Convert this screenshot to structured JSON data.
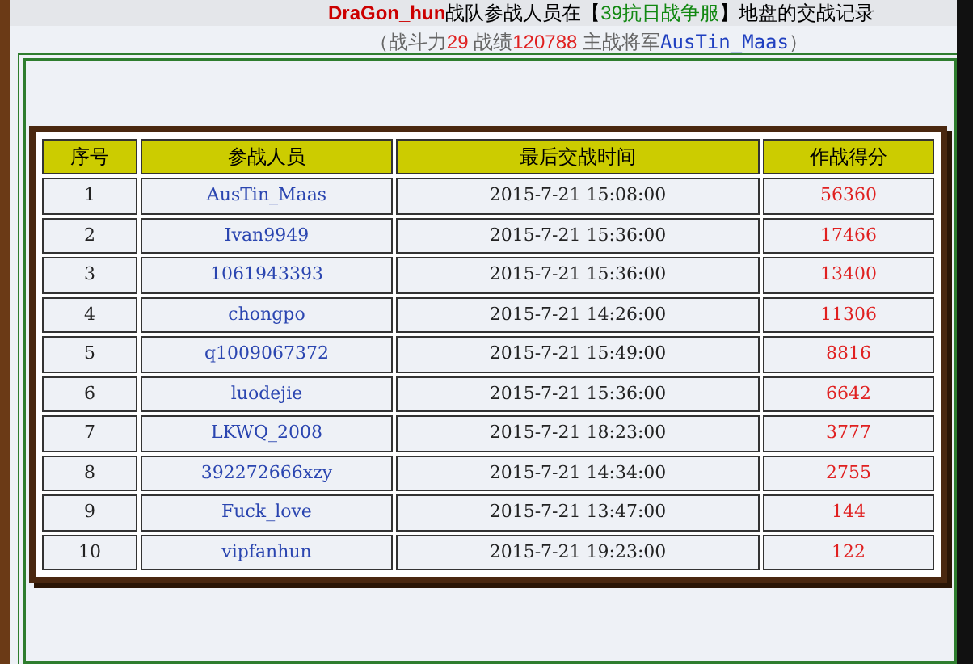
{
  "title": {
    "team": "DraGon_hun",
    "text_before": "战队参战人员在【",
    "server": "39抗日战争服",
    "text_after": "】地盘的交战记录"
  },
  "summary": {
    "open": "（",
    "power_label": "战斗力",
    "power": "29",
    "record_label": " 战绩",
    "record": "120788",
    "general_label": " 主战将军",
    "general": "AusTin_Maas",
    "close": "）"
  },
  "table": {
    "columns": [
      "序号",
      "参战人员",
      "最后交战时间",
      "作战得分"
    ],
    "rows": [
      [
        "1",
        "AusTin_Maas",
        "2015-7-21 15:08:00",
        "56360"
      ],
      [
        "2",
        "Ivan9949",
        "2015-7-21 15:36:00",
        "17466"
      ],
      [
        "3",
        "1061943393",
        "2015-7-21 15:36:00",
        "13400"
      ],
      [
        "4",
        "chongpo",
        "2015-7-21 14:26:00",
        "11306"
      ],
      [
        "5",
        "q1009067372",
        "2015-7-21 15:49:00",
        "8816"
      ],
      [
        "6",
        "luodejie",
        "2015-7-21 15:36:00",
        "6642"
      ],
      [
        "7",
        "LKWQ_2008",
        "2015-7-21 18:23:00",
        "3777"
      ],
      [
        "8",
        "392272666xzy",
        "2015-7-21 14:34:00",
        "2755"
      ],
      [
        "9",
        "Fuck_love",
        "2015-7-21 13:47:00",
        "144"
      ],
      [
        "10",
        "vipfanhun",
        "2015-7-21 19:23:00",
        "122"
      ]
    ]
  }
}
